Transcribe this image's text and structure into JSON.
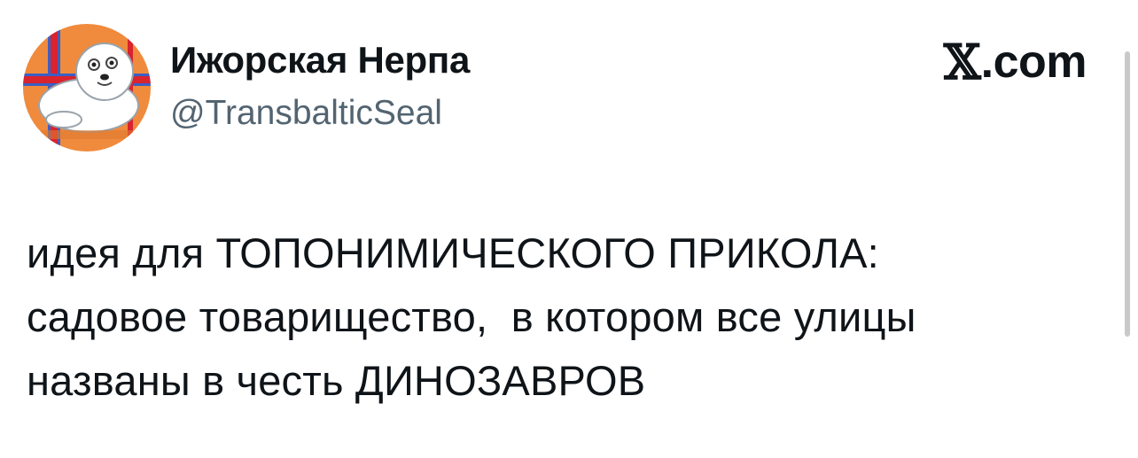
{
  "author": {
    "display_name": "Ижорская Нерпа",
    "handle": "@TransbalticSeal",
    "avatar": "seal-avatar"
  },
  "brand": {
    "logo_icon": "x-logo-icon",
    "x_glyph": "𝕏",
    "domain": ".com"
  },
  "tweet": {
    "lines": [
      "идея для ТОПОНИМИЧЕСКОГО ПРИКОЛА:",
      "садовое товарищество,  в котором все улицы",
      "названы в честь ДИНОЗАВРОВ"
    ]
  },
  "colors": {
    "text": "#0f1419",
    "secondary_text": "#536471",
    "avatar_background": "#f08a3c",
    "avatar_flag_red": "#d9232e",
    "avatar_flag_blue": "#3b5fc4"
  }
}
